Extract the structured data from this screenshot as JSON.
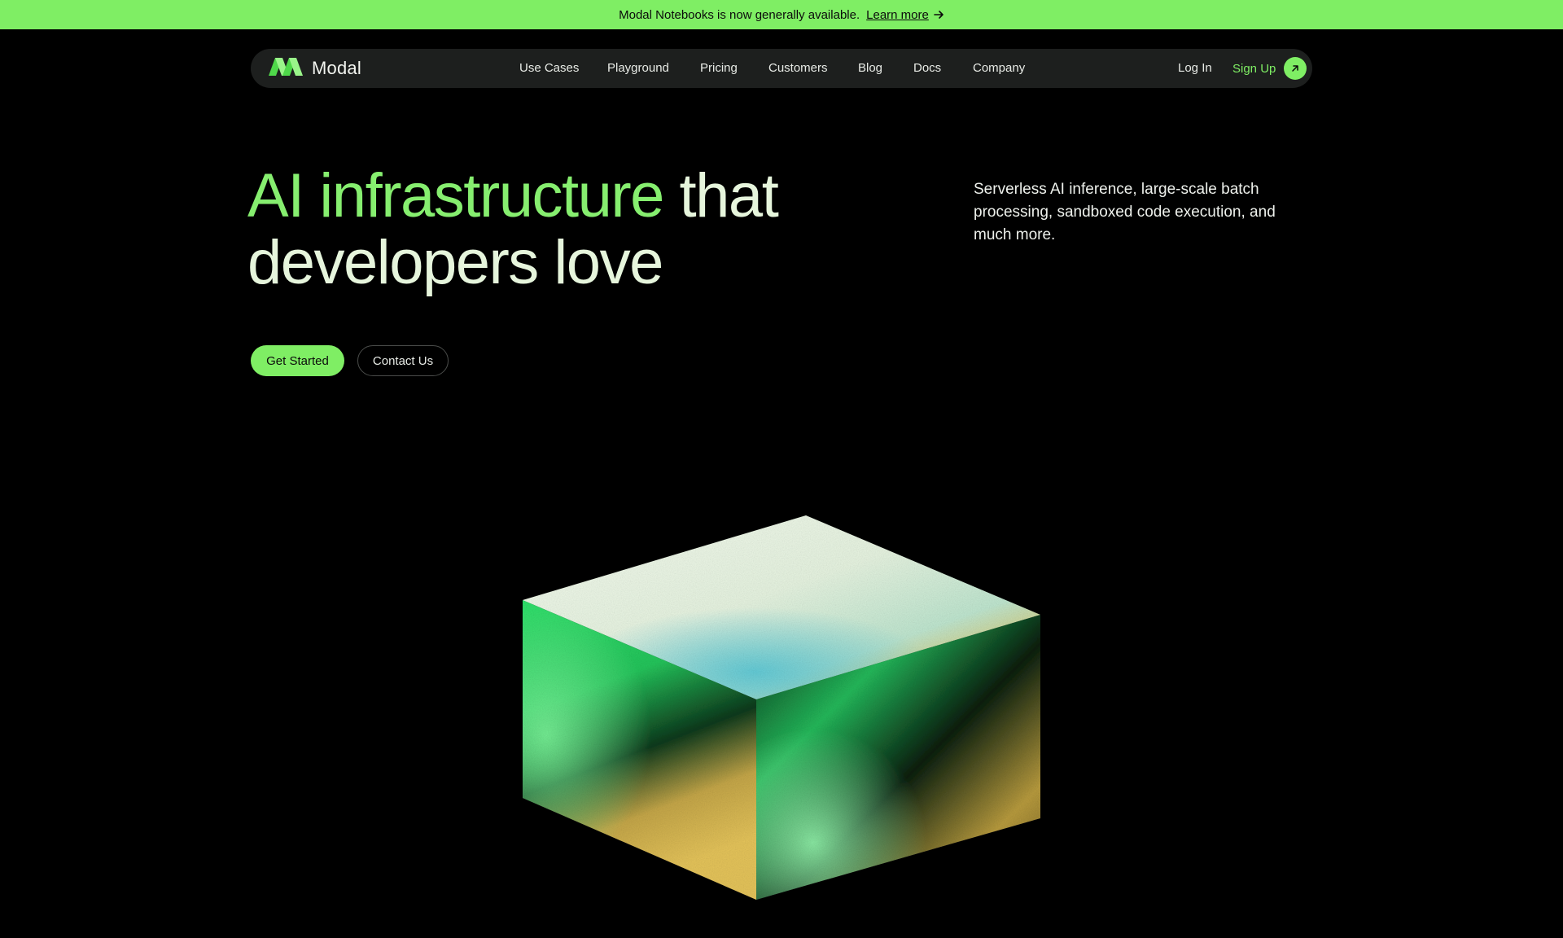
{
  "banner": {
    "message": "Modal Notebooks is now generally available.",
    "link_label": "Learn more",
    "icon": "arrow-right-icon"
  },
  "nav": {
    "logo_text": "Modal",
    "logo_icon": "modal-logo-icon",
    "links": [
      "Use Cases",
      "Playground",
      "Pricing",
      "Customers",
      "Blog",
      "Docs",
      "Company"
    ],
    "login_label": "Log In",
    "signup_label": "Sign Up",
    "signup_icon": "arrow-up-right-icon"
  },
  "hero": {
    "headline_accent": "AI infrastructure",
    "headline_rest_1": " that",
    "headline_rest_2": "developers love",
    "subtext": "Serverless AI inference, large-scale batch processing, sandboxed code execution, and much more.",
    "primary_cta": "Get Started",
    "secondary_cta": "Contact Us",
    "illustration": "gradient-cube-illustration"
  },
  "colors": {
    "accent_green": "#7fee64",
    "background": "#000000",
    "nav_background": "#1d1f1e",
    "headline_text": "#e6f5dc"
  }
}
